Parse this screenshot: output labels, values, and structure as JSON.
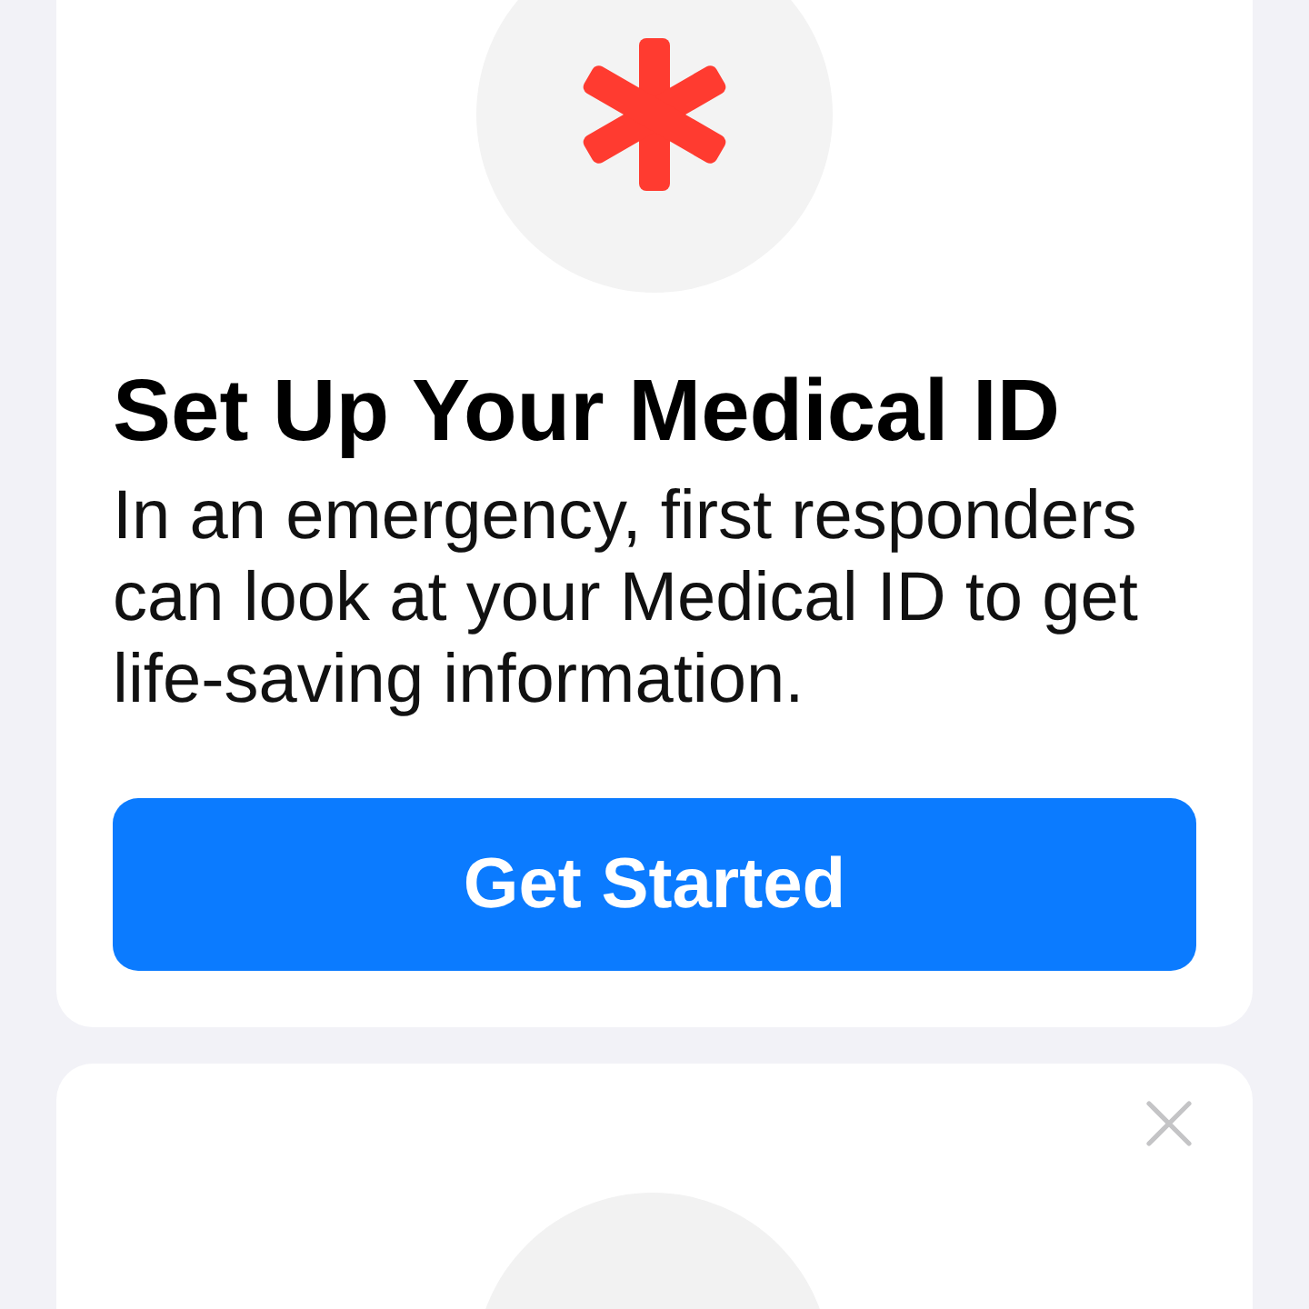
{
  "cards": [
    {
      "kind": "feature",
      "title": "Set Up Your Medical ID",
      "body": "In an emergency, first responders can look at your Medical ID to get life-saving information.",
      "button": "Get Started"
    },
    {
      "kind": "partial",
      "dismissible": true
    }
  ]
}
